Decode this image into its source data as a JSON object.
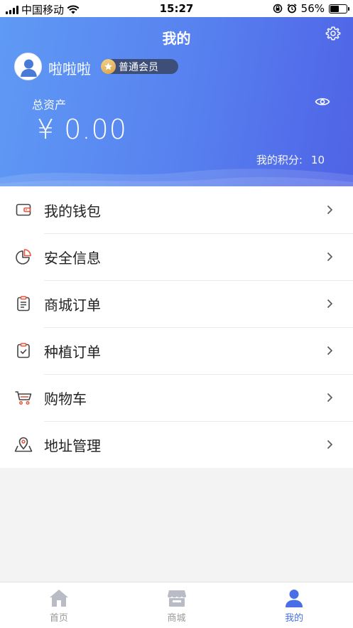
{
  "status_bar": {
    "carrier": "中国移动",
    "time": "15:27",
    "battery": "56%"
  },
  "header": {
    "title": "我的",
    "username": "啦啦啦",
    "member_level": "普通会员",
    "assets_label": "总资产",
    "assets_amount": "¥ 0.00",
    "points_label": "我的积分:",
    "points_value": "10"
  },
  "menu": {
    "items": [
      {
        "label": "我的钱包",
        "icon": "wallet-icon"
      },
      {
        "label": "安全信息",
        "icon": "pie-chart-icon"
      },
      {
        "label": "商城订单",
        "icon": "clipboard-list-icon"
      },
      {
        "label": "种植订单",
        "icon": "clipboard-check-icon"
      },
      {
        "label": "购物车",
        "icon": "cart-icon"
      },
      {
        "label": "地址管理",
        "icon": "map-pin-icon"
      }
    ]
  },
  "tabbar": {
    "tabs": [
      {
        "label": "首页",
        "icon": "home-icon"
      },
      {
        "label": "商城",
        "icon": "store-icon"
      },
      {
        "label": "我的",
        "icon": "user-icon",
        "active": true
      }
    ]
  },
  "colors": {
    "accent": "#4a6ee8",
    "header_gradient_start": "#5f9af5",
    "header_gradient_end": "#4f63e6",
    "icon_accent": "#e8553f"
  }
}
